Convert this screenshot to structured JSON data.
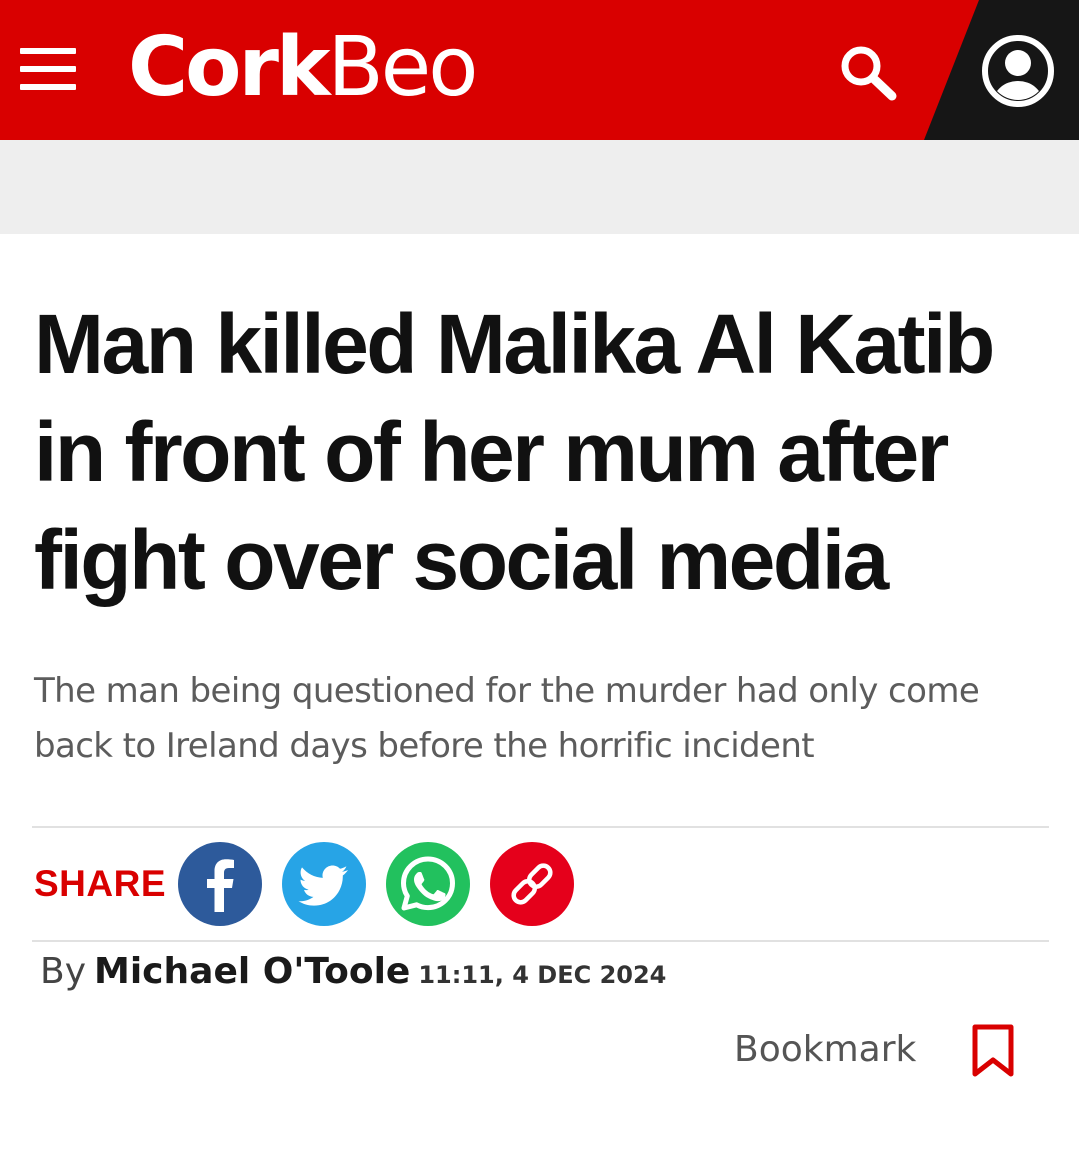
{
  "header": {
    "logo_part1": "Cork",
    "logo_part2": "Beo",
    "menu_icon": "hamburger-menu-icon",
    "search_icon": "search-icon",
    "account_icon": "user-account-icon"
  },
  "article": {
    "headline": "Man killed Malika Al Katib in front of her mum after fight over social media",
    "standfirst": "The man being questioned for the murder had only come back to Ireland days before the horrific incident"
  },
  "share": {
    "label": "SHARE",
    "buttons": [
      {
        "icon": "facebook-icon",
        "color": "#3b5998"
      },
      {
        "icon": "twitter-icon",
        "color": "#1da1f2"
      },
      {
        "icon": "whatsapp-icon",
        "color": "#25d366"
      },
      {
        "icon": "link-icon",
        "color": "#d90000"
      }
    ]
  },
  "byline": {
    "prefix": "By",
    "author": "Michael O'Toole",
    "timestamp": "11:11, 4 DEC 2024"
  },
  "bookmark": {
    "label": "Bookmark",
    "icon": "bookmark-icon"
  },
  "colors": {
    "brand_red": "#d90000",
    "header_dark": "#161616",
    "ad_band": "#eeeeee"
  }
}
